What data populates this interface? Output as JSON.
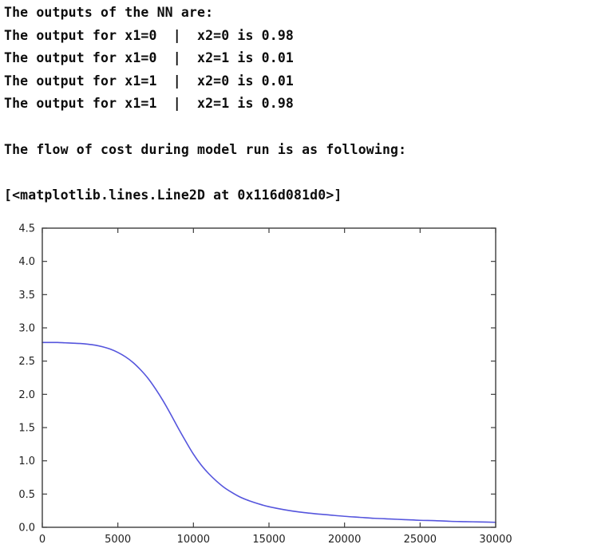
{
  "console": {
    "lines": [
      "The outputs of the NN are:",
      "The output for x1=0  |  x2=0 is 0.98",
      "The output for x1=0  |  x2=1 is 0.01",
      "The output for x1=1  |  x2=0 is 0.01",
      "The output for x1=1  |  x2=1 is 0.98",
      "",
      "The flow of cost during model run is as following:"
    ],
    "repr_output": "[<matplotlib.lines.Line2D at 0x116d081d0>]"
  },
  "chart_data": {
    "type": "line",
    "title": "",
    "xlabel": "",
    "ylabel": "",
    "xlim": [
      0,
      30000
    ],
    "ylim": [
      0.0,
      4.5
    ],
    "grid": false,
    "legend": null,
    "line_color": "#5555dd",
    "line_width": 1.6,
    "xticks": [
      0,
      5000,
      10000,
      15000,
      20000,
      25000,
      30000
    ],
    "xtick_labels": [
      "0",
      "5000",
      "10000",
      "15000",
      "20000",
      "25000",
      "30000"
    ],
    "yticks": [
      0.0,
      0.5,
      1.0,
      1.5,
      2.0,
      2.5,
      3.0,
      3.5,
      4.0,
      4.5
    ],
    "ytick_labels": [
      "0.0",
      "0.5",
      "1.0",
      "1.5",
      "2.0",
      "2.5",
      "3.0",
      "3.5",
      "4.0",
      "4.5"
    ],
    "series": [
      {
        "name": "cost",
        "x": [
          0,
          250,
          500,
          750,
          1000,
          1500,
          2000,
          2500,
          3000,
          3500,
          4000,
          4500,
          5000,
          5500,
          6000,
          6500,
          7000,
          7500,
          8000,
          8500,
          9000,
          9500,
          10000,
          10500,
          11000,
          11500,
          12000,
          12500,
          13000,
          13500,
          14000,
          14500,
          15000,
          16000,
          17000,
          18000,
          19000,
          20000,
          21000,
          22000,
          23000,
          24000,
          25000,
          26000,
          27000,
          28000,
          29000,
          30000
        ],
        "y": [
          2.78,
          2.78,
          2.78,
          2.78,
          2.78,
          2.775,
          2.77,
          2.765,
          2.755,
          2.74,
          2.715,
          2.68,
          2.63,
          2.565,
          2.48,
          2.37,
          2.24,
          2.08,
          1.9,
          1.7,
          1.49,
          1.29,
          1.1,
          0.94,
          0.81,
          0.7,
          0.605,
          0.53,
          0.465,
          0.415,
          0.375,
          0.34,
          0.31,
          0.265,
          0.23,
          0.205,
          0.185,
          0.165,
          0.15,
          0.135,
          0.125,
          0.115,
          0.105,
          0.1,
          0.09,
          0.085,
          0.08,
          0.075
        ]
      }
    ]
  }
}
